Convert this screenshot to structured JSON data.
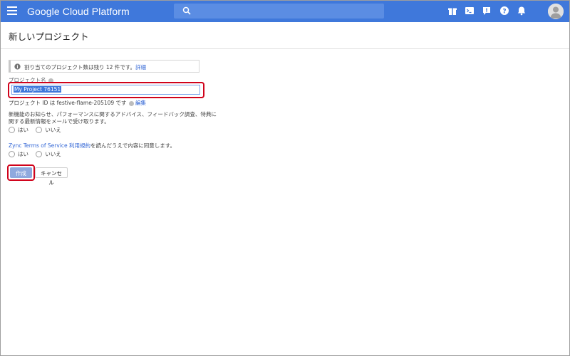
{
  "topbar": {
    "brand": "Google Cloud Platform",
    "search_placeholder": "",
    "icons": [
      "gift-icon",
      "terminal-icon",
      "alert-icon",
      "help-icon",
      "notifications-icon"
    ],
    "accent": "#3f78db"
  },
  "page": {
    "title": "新しいプロジェクト"
  },
  "form": {
    "quota_text": "割り当てのプロジェクト数は残り 12 件です。",
    "quota_link": "詳細",
    "project_name_label": "プロジェクト名",
    "project_name_value": "My Project 76151",
    "project_id_prefix": "プロジェクト ID は festive-flame-205109 です",
    "project_id_edit": "編集",
    "newsletter_line1": "新機能のお知らせ、パフォーマンスに関するアドバイス、フィードバック調査、特典に",
    "newsletter_line2": "関する最新情報をメールで受け取ります。",
    "yes": "はい",
    "no": "いいえ",
    "tos_link": "Zync Terms of Service 利用規約",
    "tos_text": "を読んだうえで内容に同意します。",
    "create_label": "作成",
    "cancel_label": "キャンセル"
  }
}
